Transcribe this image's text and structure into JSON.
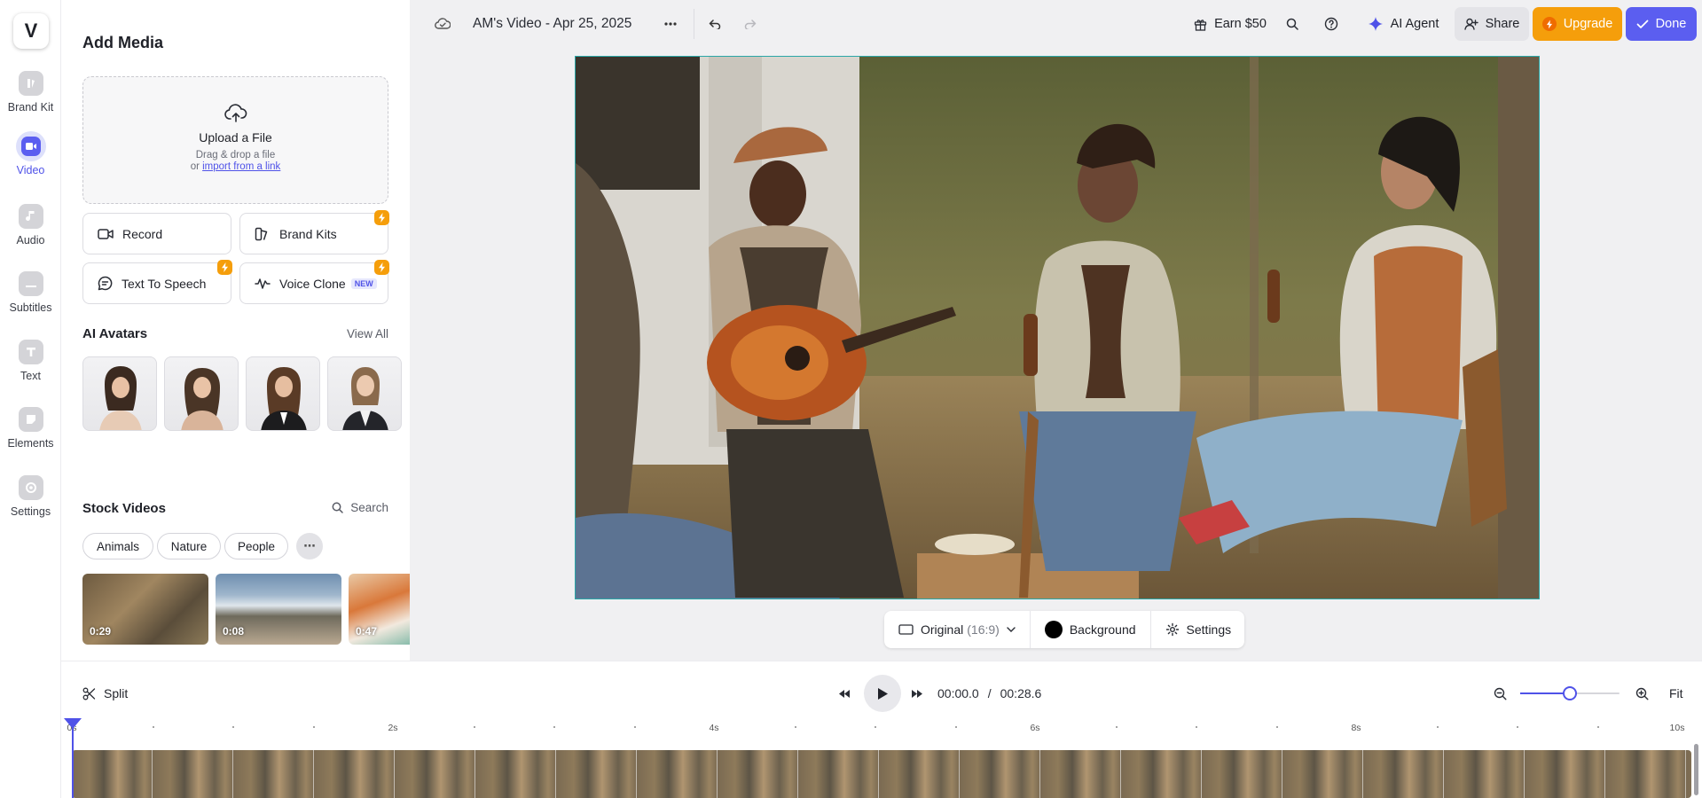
{
  "rail": {
    "logo": "V",
    "items": [
      {
        "label": "Brand Kit",
        "icon": "brand-kit-icon"
      },
      {
        "label": "Video",
        "icon": "video-camera-icon",
        "active": true
      },
      {
        "label": "Audio",
        "icon": "music-note-icon"
      },
      {
        "label": "Subtitles",
        "icon": "subtitles-icon"
      },
      {
        "label": "Text",
        "icon": "text-icon"
      },
      {
        "label": "Elements",
        "icon": "elements-icon"
      },
      {
        "label": "Settings",
        "icon": "settings-icon"
      }
    ]
  },
  "panel": {
    "title": "Add Media",
    "upload": {
      "title": "Upload a File",
      "subtitle": "Drag & drop a file",
      "or_text": "or",
      "link_text": "import from a link"
    },
    "tiles": {
      "record": "Record",
      "brand_kits": "Brand Kits",
      "text_to_speech": "Text To Speech",
      "voice_clone": "Voice Clone",
      "new_badge": "NEW"
    },
    "ai_avatars": {
      "title": "AI Avatars",
      "view_all": "View All"
    },
    "stock_videos": {
      "title": "Stock Videos",
      "search_label": "Search",
      "chips": [
        "Animals",
        "Nature",
        "People"
      ],
      "items": [
        {
          "duration": "0:29"
        },
        {
          "duration": "0:08"
        },
        {
          "duration": "0:47"
        }
      ]
    }
  },
  "topbar": {
    "project_title": "AM's Video - Apr 25, 2025",
    "earn": "Earn $50",
    "ai_agent": "AI Agent",
    "share": "Share",
    "upgrade": "Upgrade",
    "done": "Done"
  },
  "canvas_tools": {
    "aspect_label": "Original",
    "aspect_ratio": "(16:9)",
    "background": "Background",
    "settings": "Settings"
  },
  "timeline": {
    "split": "Split",
    "current_time": "00:00.0",
    "separator": "/",
    "total_time": "00:28.6",
    "fit": "Fit",
    "zoom_level": 0.5,
    "ruler_labels": [
      "0s",
      "2s",
      "4s",
      "6s",
      "8s",
      "10s"
    ]
  },
  "colors": {
    "accent": "#5b5ef0",
    "upgrade": "#f59e0b",
    "canvas_border": "#2aa7a7"
  }
}
